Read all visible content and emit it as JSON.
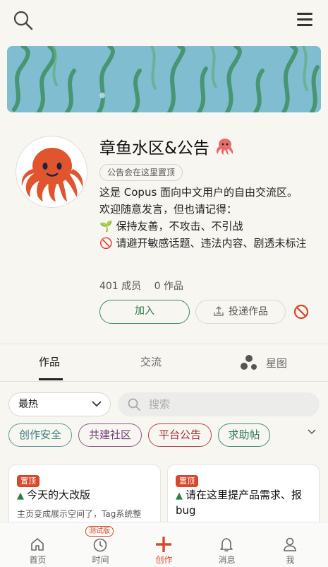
{
  "header": {
    "search_icon": "search-icon",
    "menu_icon": "hamburger-menu-icon"
  },
  "profile": {
    "title": "章鱼水区&公告",
    "pin_tag": "公告会在这里置顶",
    "description": [
      "这是 Copus 面向中文用户的自由交流区。",
      "欢迎随意发言，但也请记得：",
      "🌱 保持友善，不攻击、不引战",
      "🚫 请避开敏感话题、违法内容、剧透未标注"
    ],
    "members": "401 成员",
    "works": "0 作品",
    "join_label": "加入",
    "submit_label": "投递作品"
  },
  "tabs": {
    "works": "作品",
    "discuss": "交流",
    "starmap": "星图"
  },
  "filters": {
    "sort_value": "最热",
    "search_placeholder": "搜索",
    "chips": [
      "创作安全",
      "共建社区",
      "平台公告",
      "求助帖"
    ]
  },
  "cards": [
    {
      "badge": "置顶",
      "title": "今天的大改版",
      "sub": "主页变成展示空间了，Tag系统整"
    },
    {
      "badge": "置顶",
      "title": "请在这里提产品需求、报bug"
    }
  ],
  "bottom_nav": {
    "home": "首页",
    "time": "时间",
    "trial_badge": "测试版",
    "create": "创作",
    "messages": "消息",
    "me": "我"
  },
  "colors": {
    "accent": "#d6492c",
    "green": "#3c8c5c",
    "background": "#f7f6f1"
  }
}
